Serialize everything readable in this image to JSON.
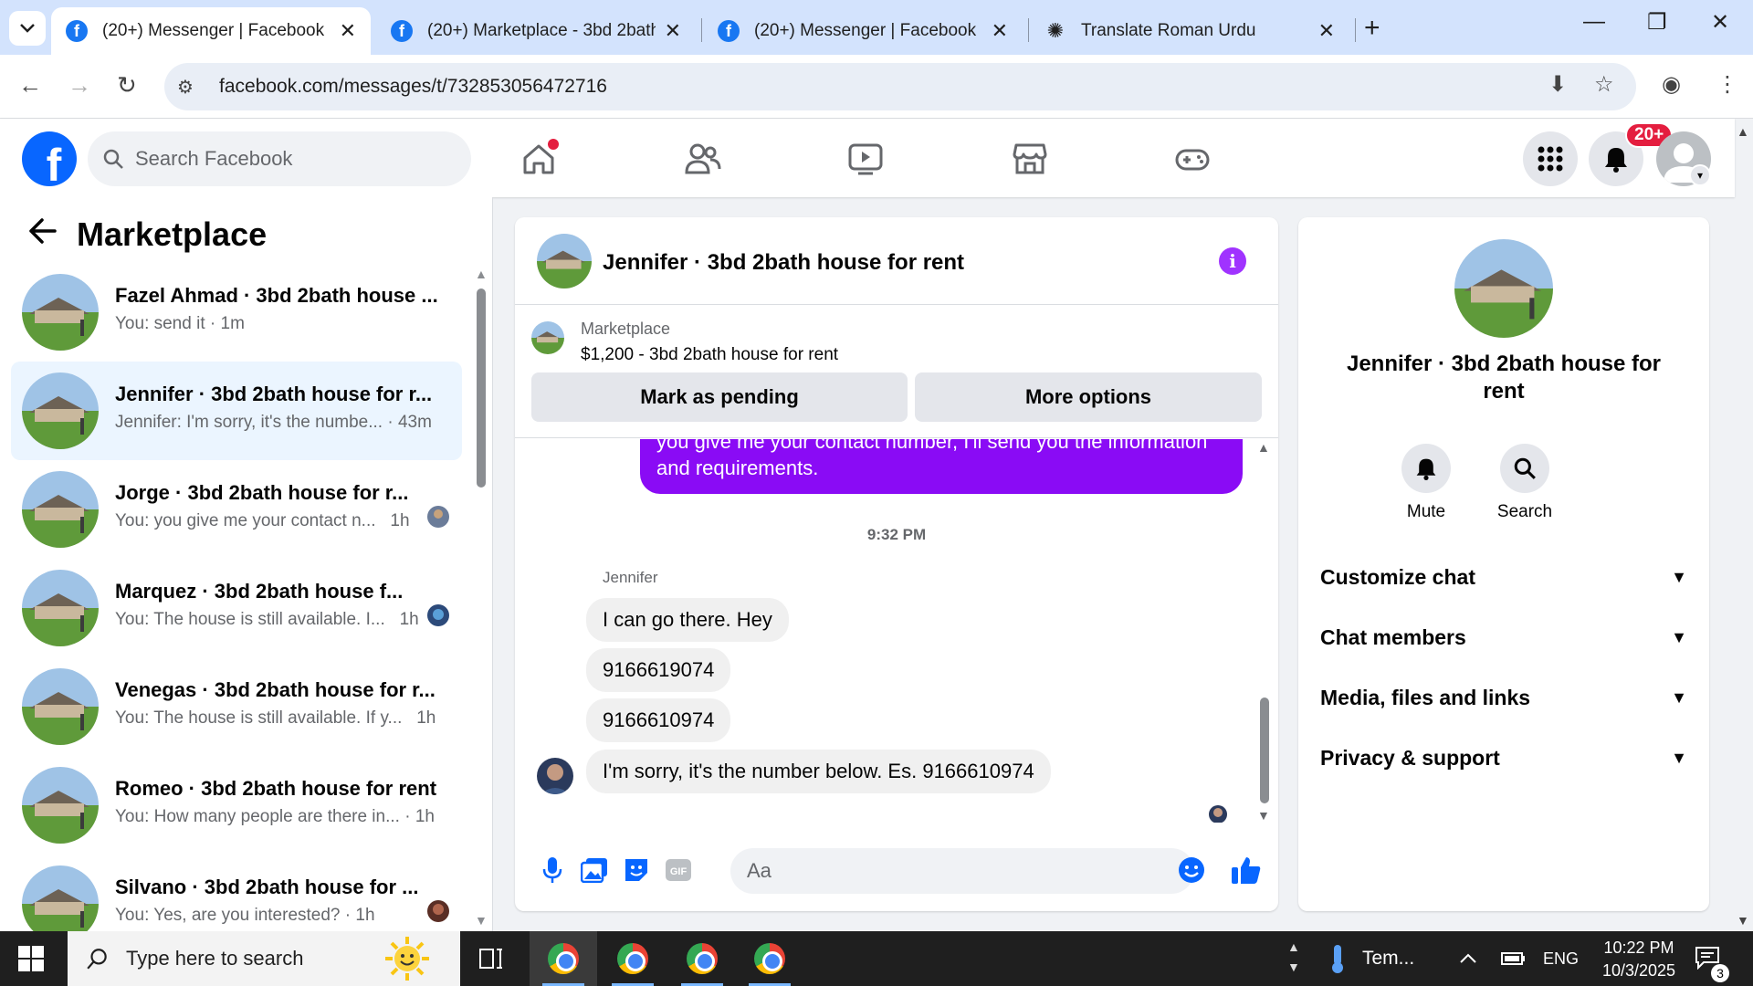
{
  "browser": {
    "tabs": [
      {
        "title": "(20+) Messenger | Facebook",
        "icon": "facebook-icon",
        "active": true
      },
      {
        "title": "(20+) Marketplace - 3bd 2bath",
        "icon": "facebook-icon",
        "active": false
      },
      {
        "title": "(20+) Messenger | Facebook",
        "icon": "facebook-icon",
        "active": false
      },
      {
        "title": "Translate Roman Urdu",
        "icon": "chatgpt-icon",
        "active": false
      }
    ],
    "url": "facebook.com/messages/t/732853056472716"
  },
  "fb": {
    "logo_letter": "f",
    "search_placeholder": "Search Facebook",
    "notification_badge": "20+",
    "colors": {
      "brand": "#0866ff",
      "accent": "#a033ff",
      "badge": "#e41e3f"
    }
  },
  "marketplace": {
    "title": "Marketplace",
    "conversations": [
      {
        "name": "Fazel Ahmad · 3bd 2bath house ...",
        "snippet": "You: send it",
        "time": "· 1m"
      },
      {
        "name": "Jennifer · 3bd 2bath house for r...",
        "snippet": "Jennifer: I'm sorry, it's the numbe...",
        "time": "· 43m"
      },
      {
        "name": "Jorge · 3bd 2bath house for r...",
        "snippet": "You: you give me your contact n...",
        "time": "1h"
      },
      {
        "name": "Marquez · 3bd 2bath house f...",
        "snippet": "You: The house is still available. I...",
        "time": "1h"
      },
      {
        "name": "Venegas · 3bd 2bath house for r...",
        "snippet": "You: The house is still available. If y...",
        "time": "1h"
      },
      {
        "name": "Romeo · 3bd 2bath house for rent",
        "snippet": "You: How many people are there in...",
        "time": "· 1h"
      },
      {
        "name": "Silvano · 3bd 2bath house for ...",
        "snippet": "You: Yes, are you interested?",
        "time": "· 1h"
      }
    ]
  },
  "chat": {
    "title": "Jennifer · 3bd 2bath house for rent",
    "listing_label": "Marketplace",
    "listing_title": "$1,200 - 3bd 2bath house for rent",
    "mark_pending": "Mark as pending",
    "more_options": "More options",
    "outgoing_text": "you give me your contact number, I'll send you the information and requirements.",
    "timestamp": "9:32 PM",
    "sender": "Jennifer",
    "incoming": [
      "I can go there. Hey",
      "9166619074",
      "9166610974",
      "I'm sorry, it's the number below.  Es. 9166610974"
    ],
    "composer_placeholder": "Aa"
  },
  "details": {
    "name": "Jennifer · 3bd 2bath house for rent",
    "mute": "Mute",
    "search": "Search",
    "sections": [
      "Customize chat",
      "Chat members",
      "Media, files and links",
      "Privacy & support"
    ]
  },
  "taskbar": {
    "search_placeholder": "Type here to search",
    "weather": "Tem...",
    "lang": "ENG",
    "time": "10:22 PM",
    "date": "10/3/2025",
    "notifications": "3"
  }
}
